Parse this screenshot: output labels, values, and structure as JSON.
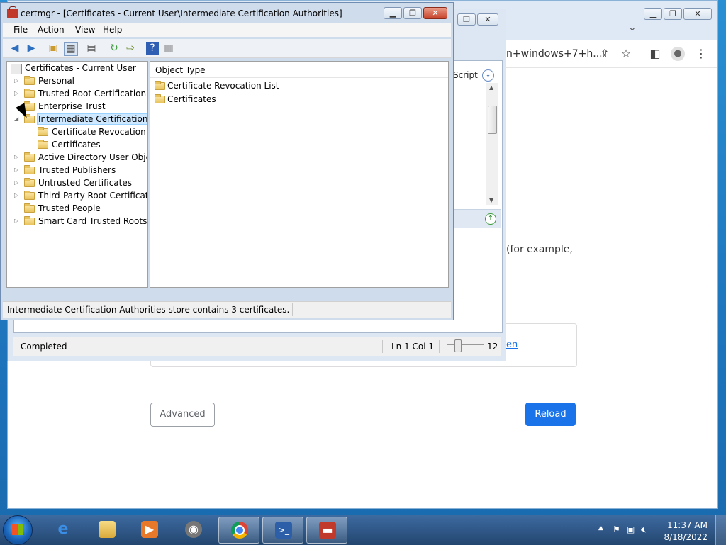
{
  "chrome": {
    "omnibox_text": "n+windows+7+h...",
    "example_text": "(for example,",
    "link_fragment": "en",
    "advanced_label": "Advanced",
    "reload_label": "Reload",
    "reload_color": "#1a73e8"
  },
  "mid_window": {
    "script_label": "Script",
    "status_text": "Completed",
    "ln_col": "Ln 1  Col 1",
    "zoom": "12"
  },
  "certmgr": {
    "title": "certmgr - [Certificates - Current User\\Intermediate Certification Authorities]",
    "menu": [
      "File",
      "Action",
      "View",
      "Help"
    ],
    "tree": [
      {
        "label": "Certificates - Current User",
        "level": 0,
        "expander": ""
      },
      {
        "label": "Personal",
        "level": 1,
        "expander": "▷"
      },
      {
        "label": "Trusted Root Certification Au",
        "level": 1,
        "expander": "▷"
      },
      {
        "label": "Enterprise Trust",
        "level": 1,
        "expander": ""
      },
      {
        "label": "Intermediate Certification Au",
        "level": 1,
        "expander": "◢",
        "selected": true
      },
      {
        "label": "Certificate Revocation List",
        "level": 2,
        "expander": ""
      },
      {
        "label": "Certificates",
        "level": 2,
        "expander": ""
      },
      {
        "label": "Active Directory User Object",
        "level": 1,
        "expander": "▷"
      },
      {
        "label": "Trusted Publishers",
        "level": 1,
        "expander": "▷"
      },
      {
        "label": "Untrusted Certificates",
        "level": 1,
        "expander": "▷"
      },
      {
        "label": "Third-Party Root Certification",
        "level": 1,
        "expander": "▷"
      },
      {
        "label": "Trusted People",
        "level": 1,
        "expander": ""
      },
      {
        "label": "Smart Card Trusted Roots",
        "level": 1,
        "expander": "▷"
      }
    ],
    "list_header": "Object Type",
    "list_items": [
      "Certificate Revocation List",
      "Certificates"
    ],
    "status_text": "Intermediate Certification Authorities store contains 3 certificates."
  },
  "taskbar": {
    "time": "11:37 AM",
    "date": "8/18/2022"
  }
}
